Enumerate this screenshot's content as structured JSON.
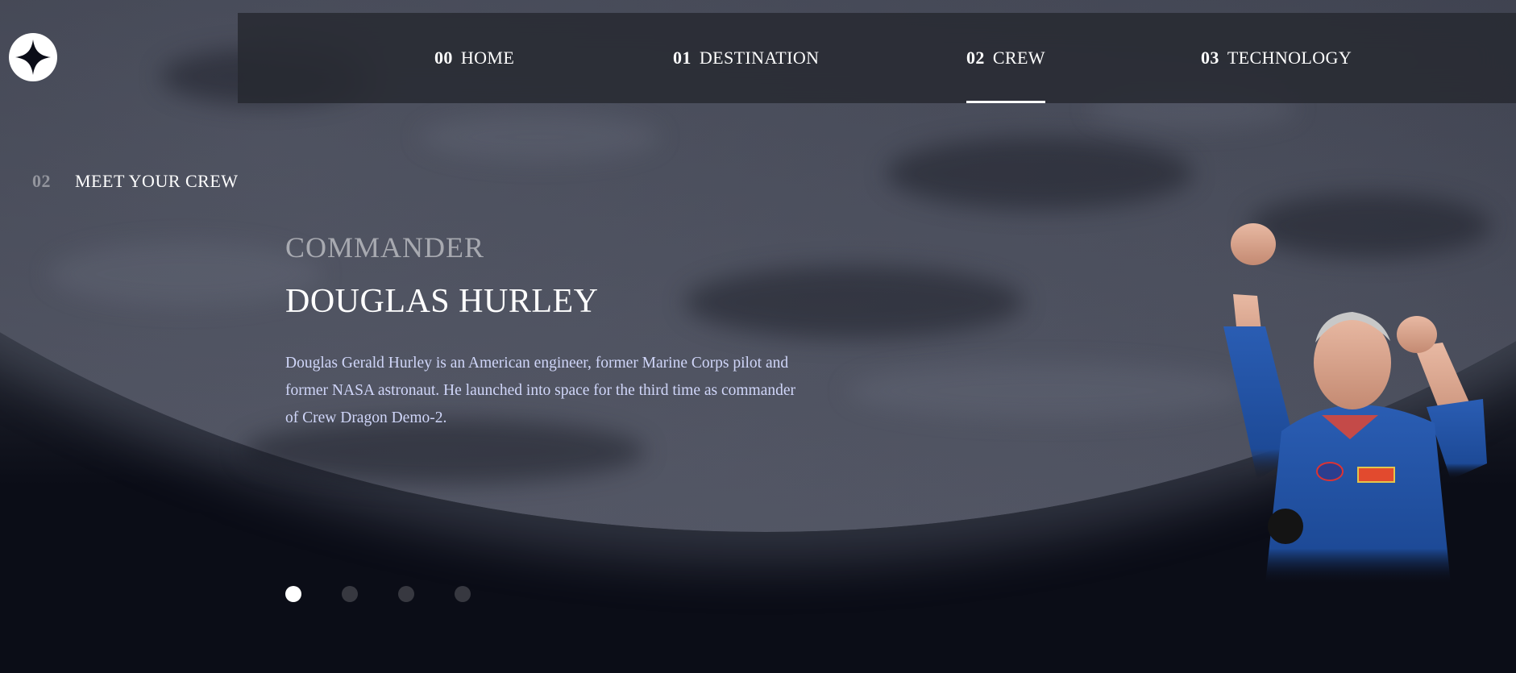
{
  "nav": {
    "items": [
      {
        "num": "00",
        "label": "HOME"
      },
      {
        "num": "01",
        "label": "DESTINATION"
      },
      {
        "num": "02",
        "label": "CREW"
      },
      {
        "num": "03",
        "label": "TECHNOLOGY"
      }
    ],
    "active_index": 2
  },
  "heading": {
    "num": "02",
    "label": "MEET YOUR CREW"
  },
  "crew": {
    "role": "COMMANDER",
    "name": "DOUGLAS HURLEY",
    "bio": "Douglas Gerald Hurley is an American engineer, former Marine Corps pilot and former NASA astronaut. He launched into space for the third time as commander of Crew Dragon Demo-2."
  },
  "carousel": {
    "count": 4,
    "active_index": 0
  },
  "icons": {
    "logo": "star-logo-icon"
  },
  "colors": {
    "background": "#0b0d17",
    "text": "#ffffff",
    "body_text": "#d0d6f9",
    "suit": "#1f4fa0"
  }
}
